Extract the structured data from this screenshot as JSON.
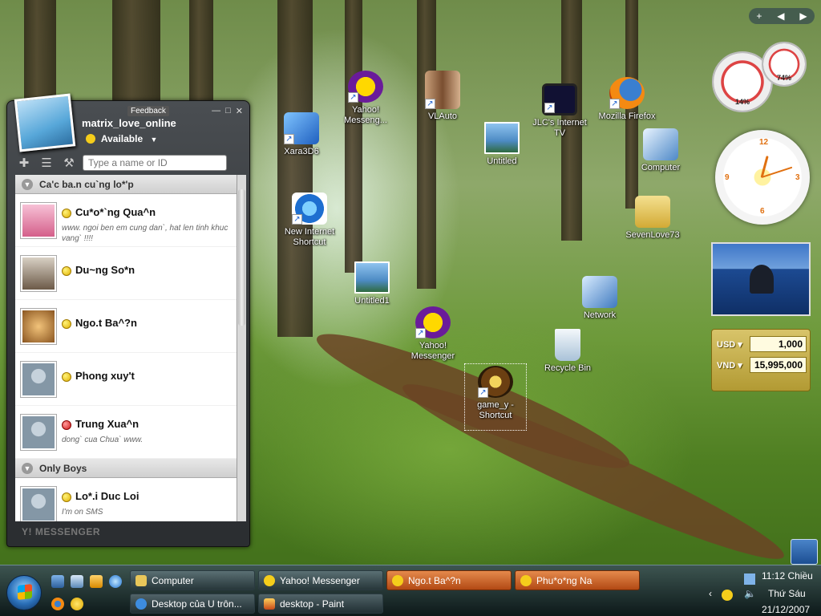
{
  "desktop_icons": [
    {
      "key": "yahoo1",
      "label": "Yahoo! Messeng..."
    },
    {
      "key": "vlauto",
      "label": "VLAuto"
    },
    {
      "key": "jlc",
      "label": "JLC's Internet TV"
    },
    {
      "key": "firefox",
      "label": "Mozilla Firefox"
    },
    {
      "key": "xara",
      "label": "Xara3D6"
    },
    {
      "key": "untitled",
      "label": "Untitled"
    },
    {
      "key": "computer",
      "label": "Computer"
    },
    {
      "key": "ie",
      "label": "New Internet Shortcut"
    },
    {
      "key": "sevenlove",
      "label": "SevenLove73"
    },
    {
      "key": "untitled1",
      "label": "Untitled1"
    },
    {
      "key": "network",
      "label": "Network"
    },
    {
      "key": "yahoo2",
      "label": "Yahoo! Messenger"
    },
    {
      "key": "recycle",
      "label": "Recycle Bin"
    },
    {
      "key": "game",
      "label": "game_y - Shortcut"
    }
  ],
  "messenger": {
    "feedback": "Feedback",
    "username": "matrix_love_online",
    "status": "Available",
    "search_placeholder": "Type a name or ID",
    "brand": "Y! MESSENGER",
    "groups": [
      {
        "name": "Ca'c ba.n cu`ng lo*'p"
      },
      {
        "name": "Only Boys"
      }
    ],
    "contacts": [
      {
        "name": "Cu*o*`ng Qua^n",
        "message": "www. ngoi ben em cung dan`, hat len tinh khuc vang` !!!!",
        "status": "available"
      },
      {
        "name": "Du~ng So*n",
        "message": "",
        "status": "available"
      },
      {
        "name": "Ngo.t Ba^?n",
        "message": "",
        "status": "available"
      },
      {
        "name": "Phong xuy't",
        "message": "",
        "status": "available"
      },
      {
        "name": "Trung Xua^n",
        "message": "dong` cua Chua` www.",
        "status": "busy"
      },
      {
        "name": "Lo*.i Duc Loi",
        "message": "I'm on SMS",
        "status": "available"
      }
    ]
  },
  "gadgets": {
    "cpu_percent": "14%",
    "mem_percent": "74%",
    "currency": [
      {
        "code": "USD",
        "amount": "1,000"
      },
      {
        "code": "VND",
        "amount": "15,995,000"
      }
    ]
  },
  "taskbar": {
    "buttons": [
      {
        "label": "Computer"
      },
      {
        "label": "Yahoo! Messenger"
      },
      {
        "label": "Ngo.t Ba^?n"
      },
      {
        "label": "Phu*o*ng Na"
      },
      {
        "label": "Desktop của U trôn..."
      },
      {
        "label": "desktop - Paint"
      }
    ],
    "time": "11:12 Chiều",
    "day": "Thứ Sáu",
    "date": "21/12/2007"
  },
  "colors": {
    "flash": "#c8601e",
    "yahoo_purple": "#6a1b9a",
    "accent_orange": "#e07010"
  }
}
